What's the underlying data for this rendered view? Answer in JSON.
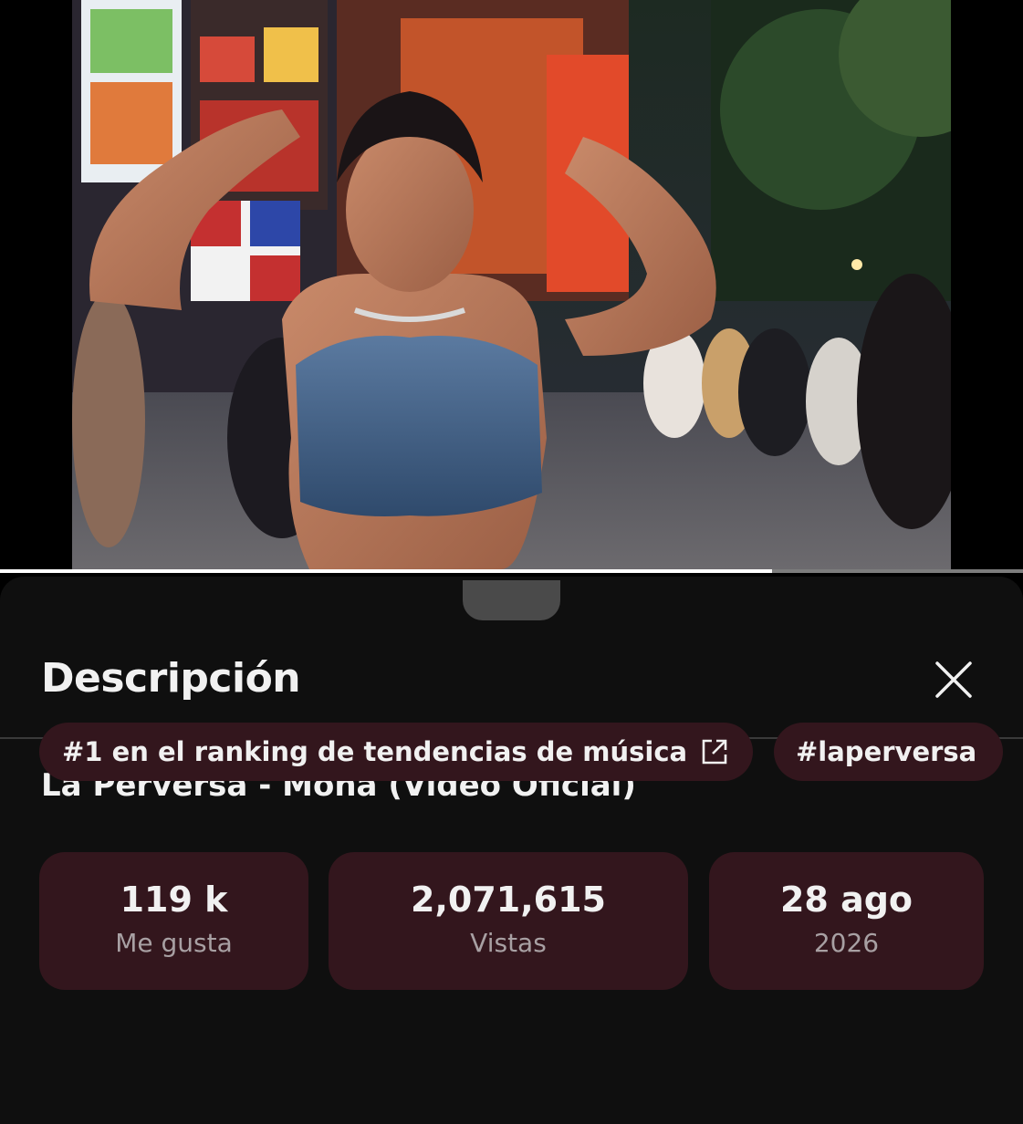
{
  "video": {
    "progress_fraction": 0.755
  },
  "sheet": {
    "title": "Descripción",
    "close_icon": "close-icon",
    "video_title": "La Perversa - Mona (Video Oficial)"
  },
  "stats": [
    {
      "value": "119 k",
      "label": "Me gusta"
    },
    {
      "value": "2,071,615",
      "label": "Vistas"
    },
    {
      "value": "28 ago",
      "label": "2026"
    }
  ],
  "chips": {
    "ranking": "#1 en el ranking de tendencias de música",
    "ranking_icon": "external-link-icon",
    "hashtag": "#laperversa"
  },
  "colors": {
    "sheet_background": "#0f0f0f",
    "card_background": "#33161d",
    "text_primary": "#f1f1f1",
    "text_secondary": "#a8a0a3"
  }
}
